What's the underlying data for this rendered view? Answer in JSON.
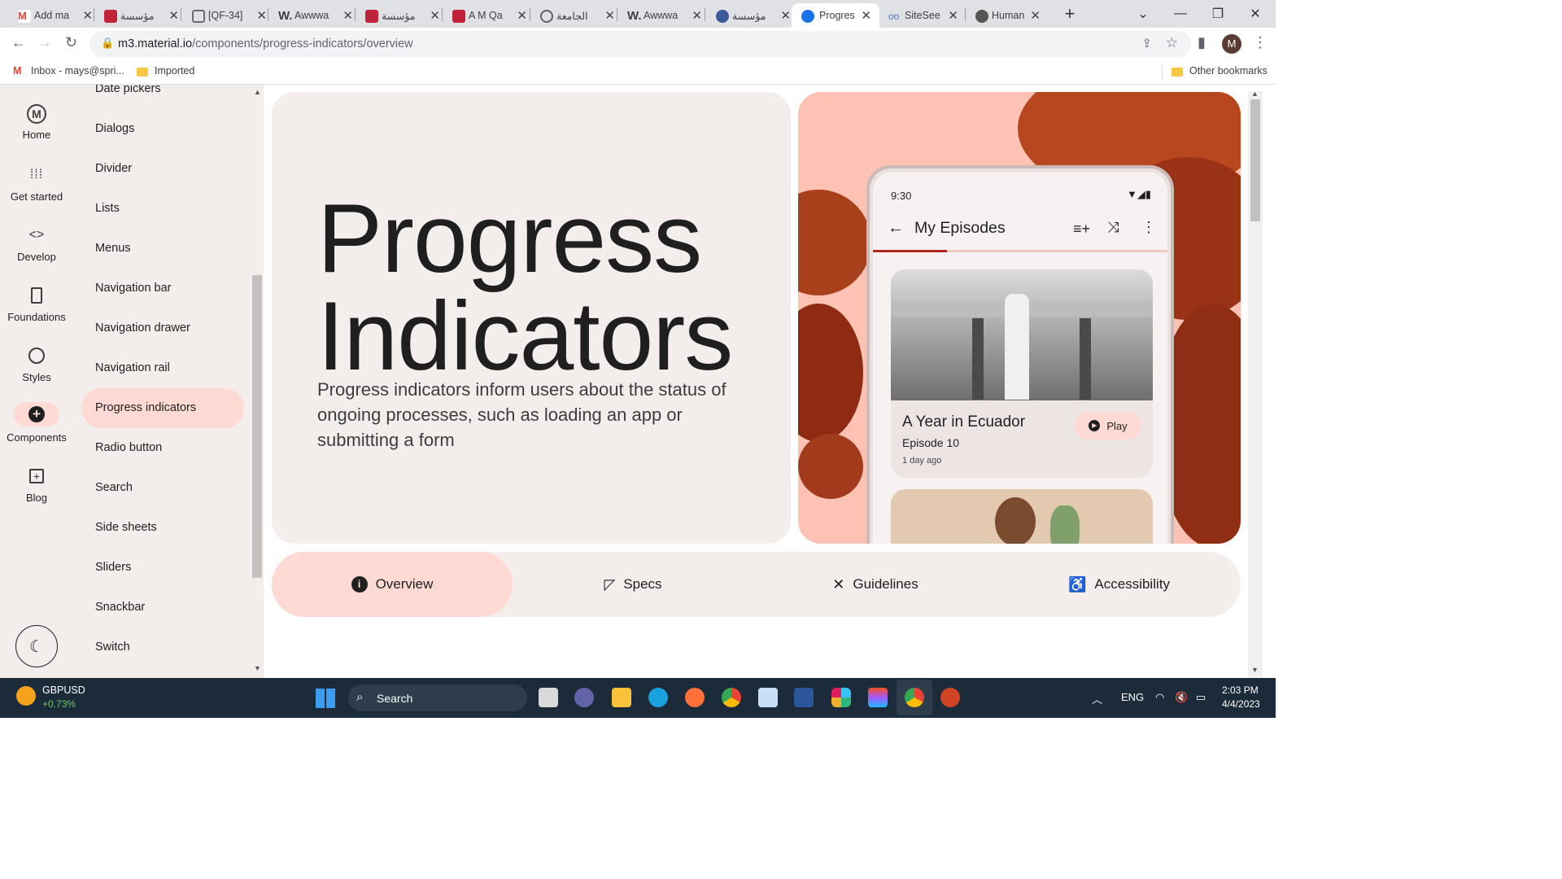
{
  "browser": {
    "tabs": [
      {
        "title": "Add ma",
        "icon": "gmail-icon",
        "color": "#ea4335"
      },
      {
        "title": "مؤسسة",
        "icon": "site-icon",
        "color": "#c0243a"
      },
      {
        "title": "[QF-34]",
        "icon": "box-icon",
        "color": "#6b6b6b"
      },
      {
        "title": "Awwwa",
        "icon": "w-icon",
        "color": "#111111"
      },
      {
        "title": "مؤسسة",
        "icon": "site-icon",
        "color": "#c0243a"
      },
      {
        "title": "A M Qa",
        "icon": "site-icon",
        "color": "#c0243a"
      },
      {
        "title": "الجامعة",
        "icon": "globe-icon",
        "color": "#5f6368"
      },
      {
        "title": "Awwwa",
        "icon": "w-icon",
        "color": "#111111"
      },
      {
        "title": "مؤسسة",
        "icon": "site-icon",
        "color": "#3b5998"
      },
      {
        "title": "Progres",
        "icon": "material-icon",
        "color": "#1a73e8"
      },
      {
        "title": "SiteSee",
        "icon": "glasses-icon",
        "color": "#4a6fd0"
      },
      {
        "title": "Human",
        "icon": "apple-icon",
        "color": "#555555"
      }
    ],
    "url_host": "m3.material.io",
    "url_path": "/components/progress-indicators/overview",
    "bookmarks": {
      "inbox": "Inbox - mays@spri...",
      "imported": "Imported",
      "other": "Other bookmarks"
    },
    "profile_initial": "M"
  },
  "rail": {
    "items": [
      {
        "label": "Home",
        "icon": "material-logo-icon",
        "glyph": "Ⓜ"
      },
      {
        "label": "Get started",
        "icon": "apps-grid-icon",
        "glyph": "⠿"
      },
      {
        "label": "Develop",
        "icon": "code-icon",
        "glyph": "<>"
      },
      {
        "label": "Foundations",
        "icon": "book-icon",
        "glyph": "▮"
      },
      {
        "label": "Styles",
        "icon": "palette-icon",
        "glyph": "🎨"
      },
      {
        "label": "Components",
        "icon": "add-circle-icon",
        "glyph": "⊕"
      },
      {
        "label": "Blog",
        "icon": "blog-icon",
        "glyph": "⊞"
      }
    ]
  },
  "sidebar": {
    "items": [
      "Date pickers",
      "Dialogs",
      "Divider",
      "Lists",
      "Menus",
      "Navigation bar",
      "Navigation drawer",
      "Navigation rail",
      "Progress indicators",
      "Radio button",
      "Search",
      "Side sheets",
      "Sliders",
      "Snackbar",
      "Switch"
    ],
    "selected": "Progress indicators"
  },
  "hero": {
    "title_line1": "Progress",
    "title_line2": "Indicators",
    "description": "Progress indicators inform users about the status of ongoing processes, such as loading an app or submitting a form"
  },
  "phone": {
    "time": "9:30",
    "app_title": "My Episodes",
    "progress_fraction": 0.25,
    "card": {
      "title": "A Year in Ecuador",
      "episode": "Episode 10",
      "time": "1 day ago",
      "play_label": "Play"
    }
  },
  "page_tabs": [
    "Overview",
    "Specs",
    "Guidelines",
    "Accessibility"
  ],
  "taskbar": {
    "ticker": "GBPUSD",
    "ticker_change": "+0.73%",
    "search": "Search",
    "lang": "ENG",
    "time": "2:03 PM",
    "date": "4/4/2023"
  },
  "colors": {
    "accent": "#ffdad4",
    "surface": "#f3edec",
    "progress": "#b3261e"
  }
}
